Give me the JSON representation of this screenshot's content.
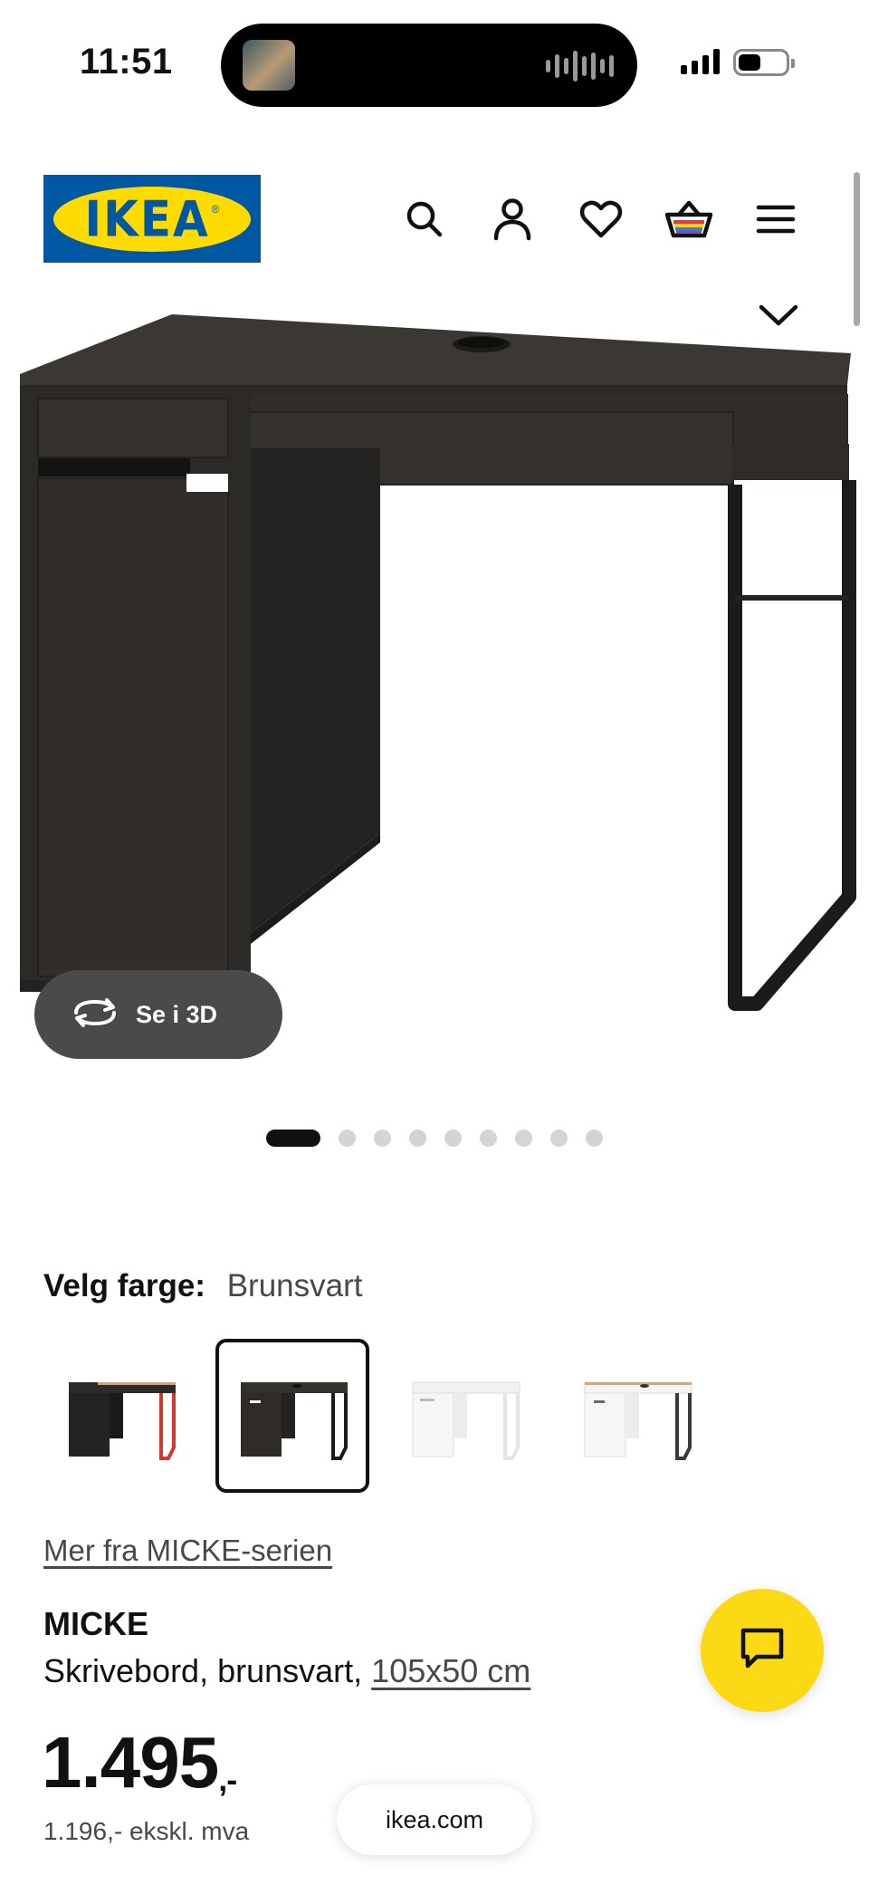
{
  "status_bar": {
    "time": "11:51",
    "icons": [
      "now-playing-artwork",
      "audio-waveform-icon",
      "cellular-signal-icon",
      "battery-icon"
    ]
  },
  "header": {
    "logo_text": "IKEA",
    "logo_registered": "®",
    "logo_colors": {
      "background": "#0058a3",
      "oval": "#ffdb00"
    },
    "icons": [
      "search-icon",
      "profile-icon",
      "heart-icon",
      "shopping-basket-icon",
      "menu-icon"
    ]
  },
  "hero": {
    "product_image": "micke-desk-black-brown",
    "collapse_icon": "chevron-down-icon",
    "view_3d_label": "Se i 3D",
    "carousel": {
      "total": 9,
      "active_index": 0
    }
  },
  "color_picker": {
    "label": "Velg farge:",
    "selected_value": "Brunsvart",
    "options": [
      {
        "name": "black-red",
        "selected": false
      },
      {
        "name": "black-brown",
        "selected": true
      },
      {
        "name": "white",
        "selected": false
      },
      {
        "name": "white-oak",
        "selected": false
      }
    ]
  },
  "series_link": "Mer fra MICKE-serien",
  "product": {
    "name": "MICKE",
    "description": "Skrivebord, brunsvart,",
    "size_link": "105x50 cm",
    "price_main": "1.495",
    "price_suffix": ",-",
    "price_ex_vat": "1.196,- ekskl. mva"
  },
  "chat": {
    "icon": "chat-bubble-icon"
  },
  "browser": {
    "url": "ikea.com"
  },
  "colors": {
    "accent_yellow": "#fbd914",
    "pill_gray": "#4a4a4a",
    "text_secondary": "#484848"
  }
}
